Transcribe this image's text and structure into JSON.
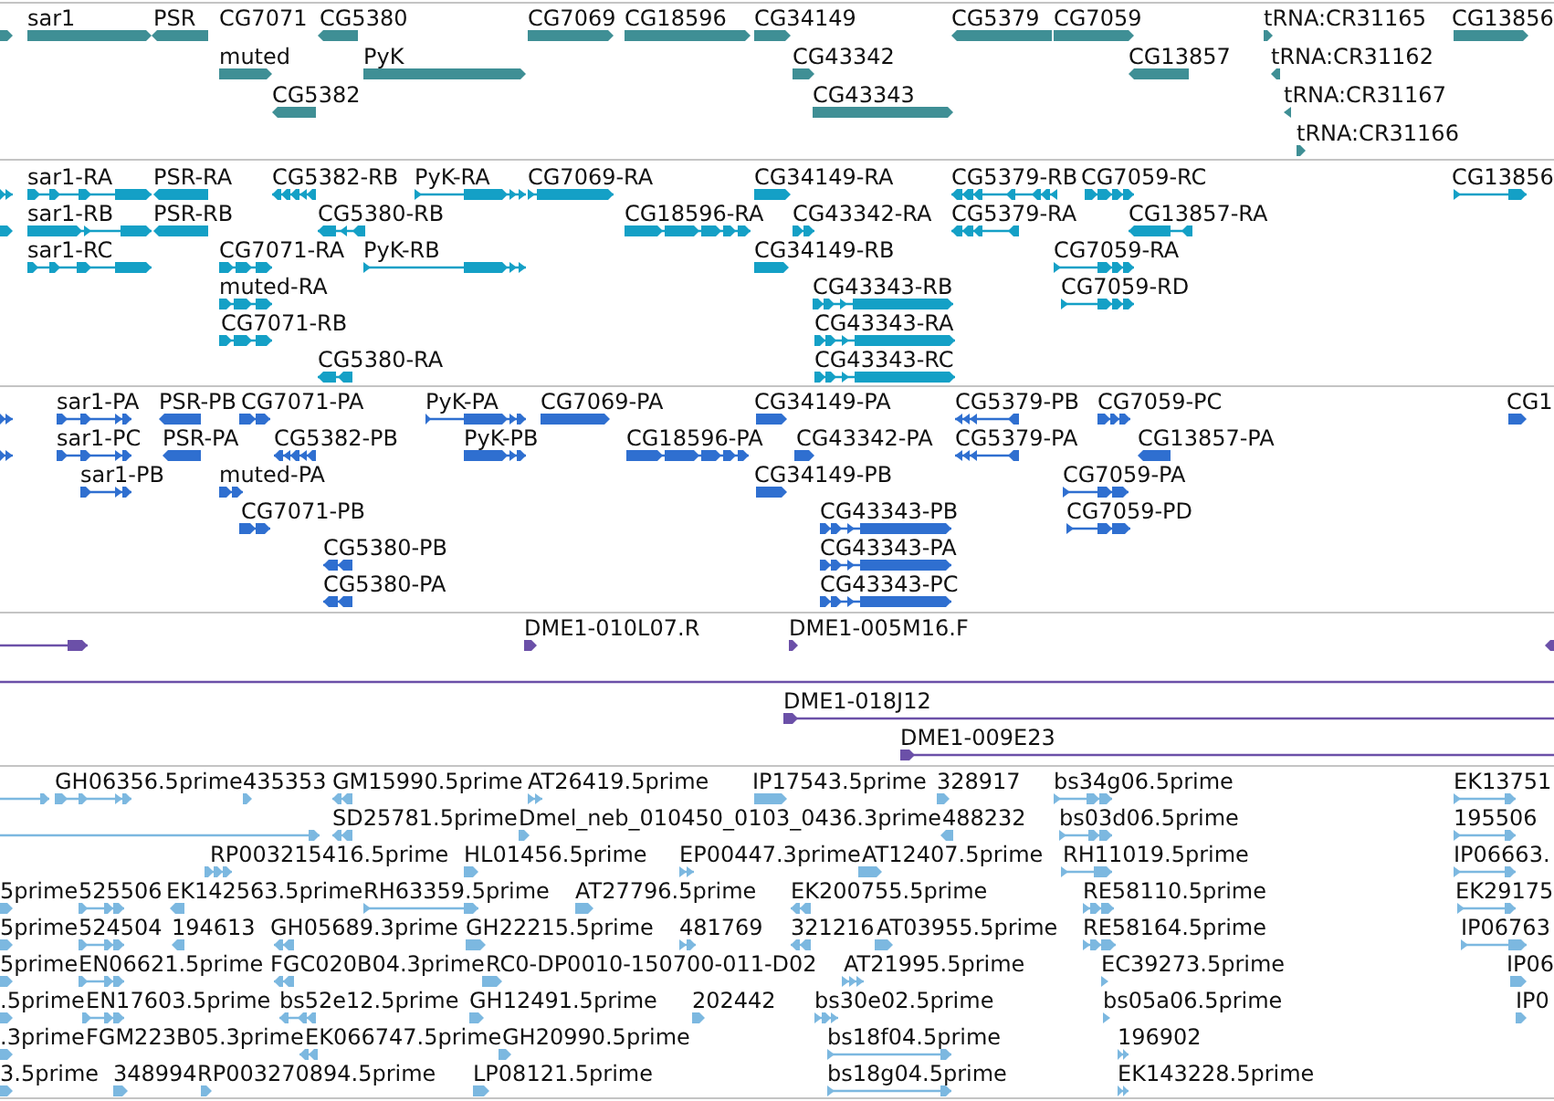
{
  "tracks": [
    {
      "kind": "genes",
      "features": [
        {
          "reverse": false
        },
        {
          "label": "sar1",
          "reverse": false
        },
        {
          "label": "PSR",
          "reverse": true
        },
        {
          "label": "CG7071"
        },
        {
          "label": "CG5380",
          "reverse": true
        },
        {
          "label": "CG7069",
          "reverse": false
        },
        {
          "label": "CG18596",
          "reverse": false
        },
        {
          "label": "CG34149",
          "reverse": false
        },
        {
          "label": "CG5379",
          "reverse": true
        },
        {
          "label": "CG7059",
          "reverse": false
        },
        {
          "label": "tRNA:CR31165",
          "reverse": false
        },
        {
          "label": "CG13856",
          "reverse": false
        },
        {
          "label": "muted",
          "reverse": false
        },
        {
          "label": "PyK",
          "reverse": false
        },
        {
          "label": "CG43342",
          "reverse": false
        },
        {
          "label": "CG13857",
          "reverse": true
        },
        {
          "label": "tRNA:CR31162",
          "reverse": true
        },
        {
          "label": "CG5382",
          "reverse": true
        },
        {
          "label": "CG43343",
          "reverse": false
        },
        {
          "label": "tRNA:CR31167",
          "reverse": true
        },
        {
          "label": "tRNA:CR31166",
          "reverse": false
        }
      ]
    },
    {
      "kind": "transcripts",
      "features": [
        {
          "reverse": false
        },
        {
          "label": "sar1-RA",
          "reverse": false
        },
        {
          "label": "PSR-RA",
          "reverse": true
        },
        {
          "label": "CG5382-RB",
          "reverse": true
        },
        {
          "label": "PyK-RA",
          "reverse": false
        },
        {
          "label": "CG7069-RA",
          "reverse": false
        },
        {
          "label": "CG34149-RA",
          "reverse": false
        },
        {
          "label": "CG5379-RB",
          "reverse": true
        },
        {
          "label": "CG7059-RC",
          "reverse": false
        },
        {
          "label": "CG13856",
          "reverse": false
        },
        {
          "reverse": false
        },
        {
          "label": "sar1-RB",
          "reverse": false
        },
        {
          "label": "PSR-RB",
          "reverse": true
        },
        {
          "label": "CG5380-RB",
          "reverse": true
        },
        {
          "label": "CG18596-RA",
          "reverse": false
        },
        {
          "label": "CG43342-RA",
          "reverse": false
        },
        {
          "label": "CG5379-RA",
          "reverse": true
        },
        {
          "label": "CG13857-RA",
          "reverse": true
        },
        {
          "label": "sar1-RC",
          "reverse": false
        },
        {
          "label": "CG7071-RA",
          "reverse": false
        },
        {
          "label": "PyK-RB",
          "reverse": false
        },
        {
          "label": "CG34149-RB",
          "reverse": false
        },
        {
          "label": "CG7059-RA",
          "reverse": false
        },
        {
          "label": "muted-RA",
          "reverse": false
        },
        {
          "label": "CG43343-RB",
          "reverse": false
        },
        {
          "label": "CG7059-RD",
          "reverse": false
        },
        {
          "label": "CG7071-RB",
          "reverse": false
        },
        {
          "label": "CG43343-RA",
          "reverse": false
        },
        {
          "label": "CG5380-RA",
          "reverse": true
        },
        {
          "label": "CG43343-RC",
          "reverse": false
        }
      ]
    },
    {
      "kind": "proteins",
      "features": [
        {
          "reverse": false
        },
        {
          "label": "sar1-PA",
          "reverse": false
        },
        {
          "label": "PSR-PB",
          "reverse": true
        },
        {
          "label": "CG7071-PA",
          "reverse": false
        },
        {
          "label": "PyK-PA",
          "reverse": false
        },
        {
          "label": "CG7069-PA",
          "reverse": false
        },
        {
          "label": "CG34149-PA",
          "reverse": false
        },
        {
          "label": "CG5379-PB",
          "reverse": true
        },
        {
          "label": "CG7059-PC",
          "reverse": false
        },
        {
          "label": "CG1",
          "reverse": false
        },
        {
          "reverse": false
        },
        {
          "label": "sar1-PC",
          "reverse": false
        },
        {
          "label": "PSR-PA",
          "reverse": true
        },
        {
          "label": "CG5382-PB",
          "reverse": true
        },
        {
          "label": "PyK-PB",
          "reverse": false
        },
        {
          "label": "CG18596-PA",
          "reverse": false
        },
        {
          "label": "CG43342-PA",
          "reverse": false
        },
        {
          "label": "CG5379-PA",
          "reverse": true
        },
        {
          "label": "CG13857-PA",
          "reverse": true
        },
        {
          "label": "sar1-PB",
          "reverse": false
        },
        {
          "label": "muted-PA",
          "reverse": false
        },
        {
          "label": "CG34149-PB",
          "reverse": false
        },
        {
          "label": "CG7059-PA",
          "reverse": false
        },
        {
          "label": "CG7071-PB",
          "reverse": false
        },
        {
          "label": "CG43343-PB",
          "reverse": false
        },
        {
          "label": "CG7059-PD",
          "reverse": false
        },
        {
          "label": "CG5380-PB",
          "reverse": true
        },
        {
          "label": "CG43343-PA",
          "reverse": false
        },
        {
          "label": "CG5380-PA",
          "reverse": true
        },
        {
          "label": "CG43343-PC",
          "reverse": false
        }
      ]
    },
    {
      "kind": "clones",
      "features": [
        {
          "reverse": false
        },
        {
          "label": "DME1-010L07.R",
          "reverse": false
        },
        {
          "label": "DME1-005M16.F",
          "reverse": false
        },
        {
          "reverse": true
        },
        {
          "label": "DME1-018J12",
          "reverse": false
        },
        {
          "label": "DME1-009E23",
          "reverse": false
        }
      ]
    },
    {
      "kind": "ests",
      "features": [
        {
          "reverse": false
        },
        {
          "label": "GH06356.5prime",
          "reverse": false
        },
        {
          "label": "435353",
          "reverse": false
        },
        {
          "label": "GM15990.5prime",
          "reverse": true
        },
        {
          "label": "AT26419.5prime",
          "reverse": false
        },
        {
          "label": "IP17543.5prime",
          "reverse": false
        },
        {
          "label": "328917",
          "reverse": false
        },
        {
          "label": "bs34g06.5prime",
          "reverse": false
        },
        {
          "label": "EK13751",
          "reverse": false
        },
        {
          "reverse": false
        },
        {
          "label": "SD25781.5prime",
          "reverse": true
        },
        {
          "label": "Dmel_neb_010450_0103_0436.3prime",
          "reverse": false
        },
        {
          "label": "488232",
          "reverse": true
        },
        {
          "label": "bs03d06.5prime",
          "reverse": false
        },
        {
          "label": "195506",
          "reverse": false
        },
        {
          "label": "RP003215416.5prime",
          "reverse": false
        },
        {
          "label": "HL01456.5prime",
          "reverse": false
        },
        {
          "label": "EP00447.3prime",
          "reverse": false
        },
        {
          "label": "AT12407.5prime",
          "reverse": false
        },
        {
          "label": "RH11019.5prime",
          "reverse": false
        },
        {
          "label": "IP06663.",
          "reverse": false
        },
        {
          "label": "5prime",
          "reverse": false
        },
        {
          "label": "525506",
          "reverse": false
        },
        {
          "label": "EK142563.5prime",
          "reverse": true
        },
        {
          "label": "RH63359.5prime",
          "reverse": false
        },
        {
          "label": "AT27796.5prime",
          "reverse": false
        },
        {
          "label": "EK200755.5prime",
          "reverse": true
        },
        {
          "label": "RE58110.5prime",
          "reverse": false
        },
        {
          "label": "EK29175",
          "reverse": false
        },
        {
          "label": "5prime",
          "reverse": false
        },
        {
          "label": "524504",
          "reverse": false
        },
        {
          "label": "194613",
          "reverse": true
        },
        {
          "label": "GH05689.3prime",
          "reverse": true
        },
        {
          "label": "GH22215.5prime",
          "reverse": false
        },
        {
          "label": "481769",
          "reverse": false
        },
        {
          "label": "321216",
          "reverse": true
        },
        {
          "label": "AT03955.5prime",
          "reverse": false
        },
        {
          "label": "RE58164.5prime",
          "reverse": false
        },
        {
          "label": "IP06763",
          "reverse": false
        },
        {
          "label": "5prime",
          "reverse": false
        },
        {
          "label": "EN06621.5prime",
          "reverse": false
        },
        {
          "label": "FGC020B04.3prime",
          "reverse": true
        },
        {
          "label": "RC0-DP0010-150700-011-D02",
          "reverse": false
        },
        {
          "label": "AT21995.5prime",
          "reverse": false
        },
        {
          "label": "EC39273.5prime",
          "reverse": false
        },
        {
          "label": "IP06",
          "reverse": false
        },
        {
          "label": ".5prime",
          "reverse": false
        },
        {
          "label": "EN17603.5prime",
          "reverse": false
        },
        {
          "label": "bs52e12.5prime",
          "reverse": true
        },
        {
          "label": "GH12491.5prime",
          "reverse": false
        },
        {
          "label": "202442",
          "reverse": false
        },
        {
          "label": "bs30e02.5prime",
          "reverse": false
        },
        {
          "label": "bs05a06.5prime",
          "reverse": false
        },
        {
          "label": "IP0",
          "reverse": false
        },
        {
          "label": ".3prime",
          "reverse": false
        },
        {
          "label": "FGM223B05.3prime"
        },
        {
          "label": "EK066747.5prime",
          "reverse": true
        },
        {
          "label": "GH20990.5prime",
          "reverse": false
        },
        {
          "label": "bs18f04.5prime",
          "reverse": false
        },
        {
          "label": "196902",
          "reverse": false
        },
        {
          "label": "3.5prime",
          "reverse": false
        },
        {
          "label": "348994",
          "reverse": false
        },
        {
          "label": "RP003270894.5prime",
          "reverse": false
        },
        {
          "label": "LP08121.5prime",
          "reverse": false
        },
        {
          "label": "bs18g04.5prime",
          "reverse": false
        },
        {
          "label": "EK143228.5prime",
          "reverse": false
        }
      ]
    }
  ]
}
